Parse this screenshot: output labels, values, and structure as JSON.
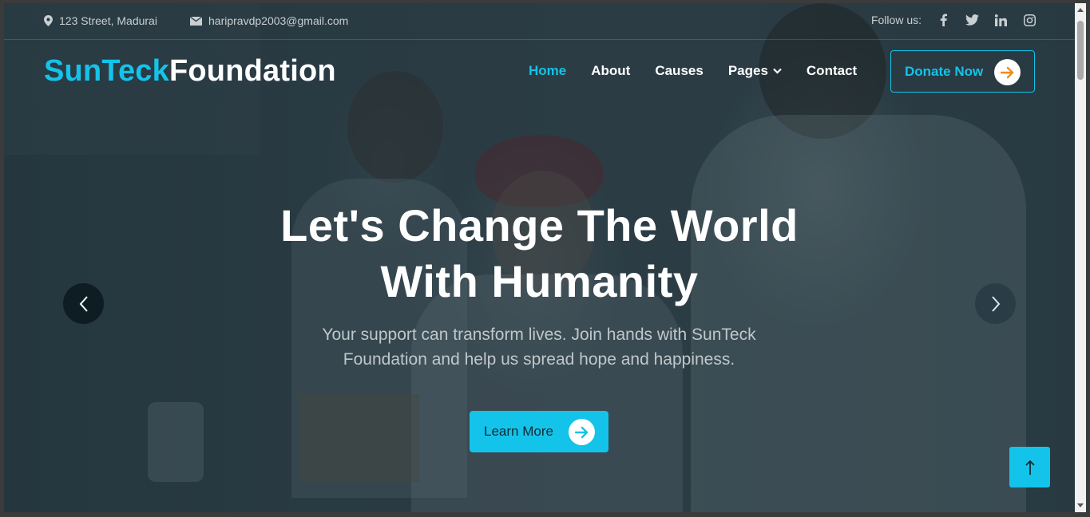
{
  "topbar": {
    "address": "123 Street, Madurai",
    "email": "haripravdp2003@gmail.com",
    "follow_label": "Follow us:",
    "socials": [
      "facebook-icon",
      "twitter-icon",
      "linkedin-icon",
      "instagram-icon"
    ]
  },
  "brand": {
    "part1": "SunTeck",
    "part2": "Foundation"
  },
  "nav": {
    "items": [
      {
        "label": "Home",
        "active": true
      },
      {
        "label": "About"
      },
      {
        "label": "Causes"
      },
      {
        "label": "Pages",
        "dropdown": true
      },
      {
        "label": "Contact"
      }
    ]
  },
  "donate": {
    "label": "Donate Now"
  },
  "hero": {
    "title_line1": "Let's Change The World",
    "title_line2": "With Humanity",
    "subtitle_line1": "Your support can transform lives. Join hands with SunTeck",
    "subtitle_line2": "Foundation and help us spread hope and happiness.",
    "cta": "Learn More"
  },
  "colors": {
    "accent": "#14c3ea",
    "orange_arrow": "#f28b1a",
    "overlay": "#1d3440"
  }
}
